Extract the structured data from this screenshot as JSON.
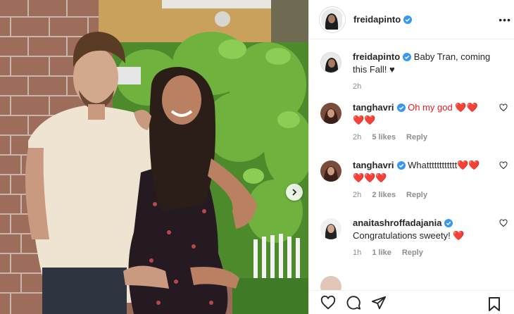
{
  "post": {
    "username": "freidapinto",
    "caption": "Baby Tran, coming this Fall! ♥",
    "caption_time": "2h"
  },
  "comments": [
    {
      "username": "tanghavri",
      "text": "Oh my god ❤️❤️ ❤️❤️",
      "time": "2h",
      "likes": "5 likes",
      "reply": "Reply"
    },
    {
      "username": "tanghavri",
      "text": "Whatttttttttttt❤️❤️ ❤️❤️❤️",
      "time": "2h",
      "likes": "2 likes",
      "reply": "Reply"
    },
    {
      "username": "anaitashroffadajania",
      "text": "Congratulations sweety! ❤️",
      "time": "1h",
      "likes": "1 like",
      "reply": "Reply"
    }
  ],
  "icons": {
    "verified": "verified-badge-icon",
    "more": "more-options-icon",
    "like": "heart-icon",
    "comment": "comment-icon",
    "share": "share-icon",
    "save": "bookmark-icon",
    "next": "chevron-right-icon"
  },
  "colors": {
    "verified": "#3897f0",
    "heart": "#ed1c24",
    "meta_text": "#8e8e8e",
    "border": "#efefef"
  }
}
